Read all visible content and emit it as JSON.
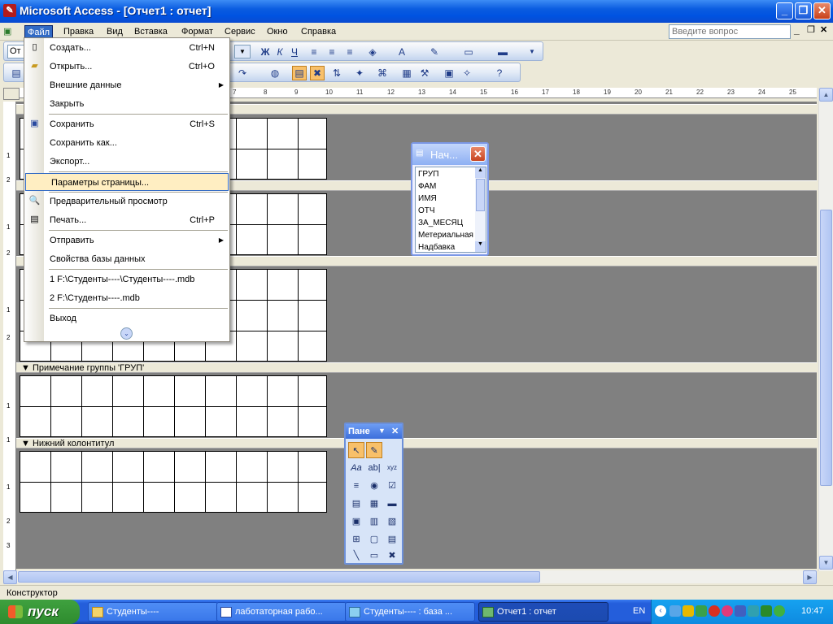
{
  "window": {
    "title": "Microsoft Access - [Отчет1 : отчет]",
    "controls": [
      "_",
      "❐",
      "✕"
    ]
  },
  "menubar": {
    "items": [
      "Файл",
      "Правка",
      "Вид",
      "Вставка",
      "Формат",
      "Сервис",
      "Окно",
      "Справка"
    ],
    "help_placeholder": "Введите вопрос",
    "doc_controls": [
      "_",
      "❐",
      "✕"
    ]
  },
  "toolbar": {
    "combo_value": "От"
  },
  "file_menu": {
    "items": [
      {
        "label": "Создать...",
        "shortcut": "Ctrl+N",
        "icon": "new-icon"
      },
      {
        "label": "Открыть...",
        "shortcut": "Ctrl+O",
        "icon": "open-icon"
      },
      {
        "label": "Внешние данные",
        "shortcut": "",
        "submenu": true
      },
      {
        "label": "Закрыть",
        "shortcut": ""
      },
      {
        "label": "Сохранить",
        "shortcut": "Ctrl+S",
        "icon": "save-icon"
      },
      {
        "label": "Сохранить как...",
        "shortcut": ""
      },
      {
        "label": "Экспорт...",
        "shortcut": ""
      },
      {
        "label": "Параметры страницы...",
        "shortcut": "",
        "selected": true
      },
      {
        "label": "Предварительный просмотр",
        "shortcut": "",
        "icon": "preview-icon"
      },
      {
        "label": "Печать...",
        "shortcut": "Ctrl+P",
        "icon": "print-icon"
      },
      {
        "label": "Отправить",
        "shortcut": "",
        "submenu": true
      },
      {
        "label": "Свойства базы данных",
        "shortcut": ""
      },
      {
        "label": "1 F:\\Студенты----\\Студенты----.mdb",
        "shortcut": ""
      },
      {
        "label": "2 F:\\Студенты----.mdb",
        "shortcut": ""
      },
      {
        "label": "Выход",
        "shortcut": ""
      }
    ]
  },
  "report": {
    "sections": {
      "group_footer": "Примечание группы 'ГРУП'",
      "page_footer": "Нижний колонтитул"
    },
    "ruler_numbers": [
      "7",
      "8",
      "9",
      "10",
      "11",
      "12",
      "13",
      "14",
      "15",
      "16",
      "17",
      "18",
      "19",
      "20",
      "21",
      "22",
      "23",
      "24",
      "25"
    ],
    "vruler_labels": [
      "1",
      "2",
      "1",
      "2",
      "1",
      "2",
      "1",
      "1",
      "1",
      "2",
      "3"
    ]
  },
  "field_list": {
    "title": "Нач...",
    "fields": [
      "ГРУП",
      "ФАМ",
      "ИМЯ",
      "ОТЧ",
      "ЗА_МЕСЯЦ",
      "Метериальная",
      "Надбавка"
    ]
  },
  "toolbox": {
    "title": "Пане",
    "tools": [
      "↖",
      "✎",
      "Aa",
      "ab|",
      "xyz",
      "≡",
      "◉",
      "☑",
      "▤",
      "▦",
      "▬",
      "▣",
      "▥",
      "▧",
      "⊞",
      "▢",
      "▤",
      "╲",
      "▭",
      "✖"
    ]
  },
  "status": {
    "text": "Конструктор"
  },
  "taskbar": {
    "start_label": "пуск",
    "tasks": [
      "Студенты----",
      "лаботаторная рабо...",
      "Студенты---- : база ...",
      "Отчет1 : отчет"
    ],
    "lang": "EN",
    "clock": "10:47"
  }
}
